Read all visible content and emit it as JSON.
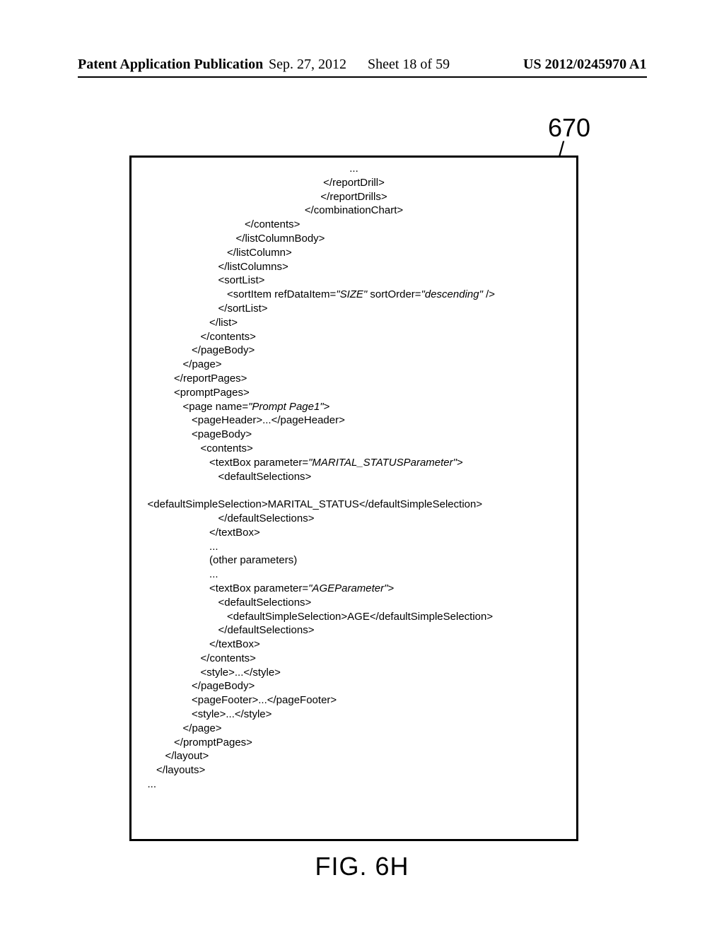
{
  "header": {
    "left": "Patent Application Publication",
    "date": "Sep. 27, 2012",
    "sheet": "Sheet 18 of 59",
    "pubno": "US 2012/0245970 A1"
  },
  "figure": {
    "ref_number": "670",
    "caption": "FIG. 6H"
  },
  "code": {
    "l00": "...",
    "l01": "</reportDrill>",
    "l02": "</reportDrills>",
    "l03": "</combinationChart>",
    "l04": "</contents>",
    "l05": "</listColumnBody>",
    "l06": "</listColumn>",
    "l07": "</listColumns>",
    "l08": "<sortList>",
    "l09a": "<sortItem refDataItem=",
    "l09b": "\"SIZE\"",
    "l09c": " sortOrder=",
    "l09d": "\"descending\"",
    "l09e": " />",
    "l10": "</sortList>",
    "l11": "</list>",
    "l12": "</contents>",
    "l13": "</pageBody>",
    "l14": "</page>",
    "l15": "</reportPages>",
    "l16": "<promptPages>",
    "l17a": "<page name=",
    "l17b": "\"Prompt Page1\"",
    "l17c": ">",
    "l18": "<pageHeader>...</pageHeader>",
    "l19": "<pageBody>",
    "l20": "<contents>",
    "l21a": "<textBox parameter=",
    "l21b": "\"MARITAL_STATUSParameter\"",
    "l21c": ">",
    "l22": "<defaultSelections>",
    "l23": "",
    "l24": "<defaultSimpleSelection>MARITAL_STATUS</defaultSimpleSelection>",
    "l25": "</defaultSelections>",
    "l26": "</textBox>",
    "l27": "...",
    "l28": "(other parameters)",
    "l29": "...",
    "l30a": "<textBox parameter=",
    "l30b": "\"AGEParameter\"",
    "l30c": ">",
    "l31": "<defaultSelections>",
    "l32": "<defaultSimpleSelection>AGE</defaultSimpleSelection>",
    "l33": "</defaultSelections>",
    "l34": "</textBox>",
    "l35": "</contents>",
    "l36": "<style>...</style>",
    "l37": "</pageBody>",
    "l38": "<pageFooter>...</pageFooter>",
    "l39": "<style>...</style>",
    "l40": "</page>",
    "l41": "</promptPages>",
    "l42": "</layout>",
    "l43": "</layouts>",
    "l44": "..."
  }
}
